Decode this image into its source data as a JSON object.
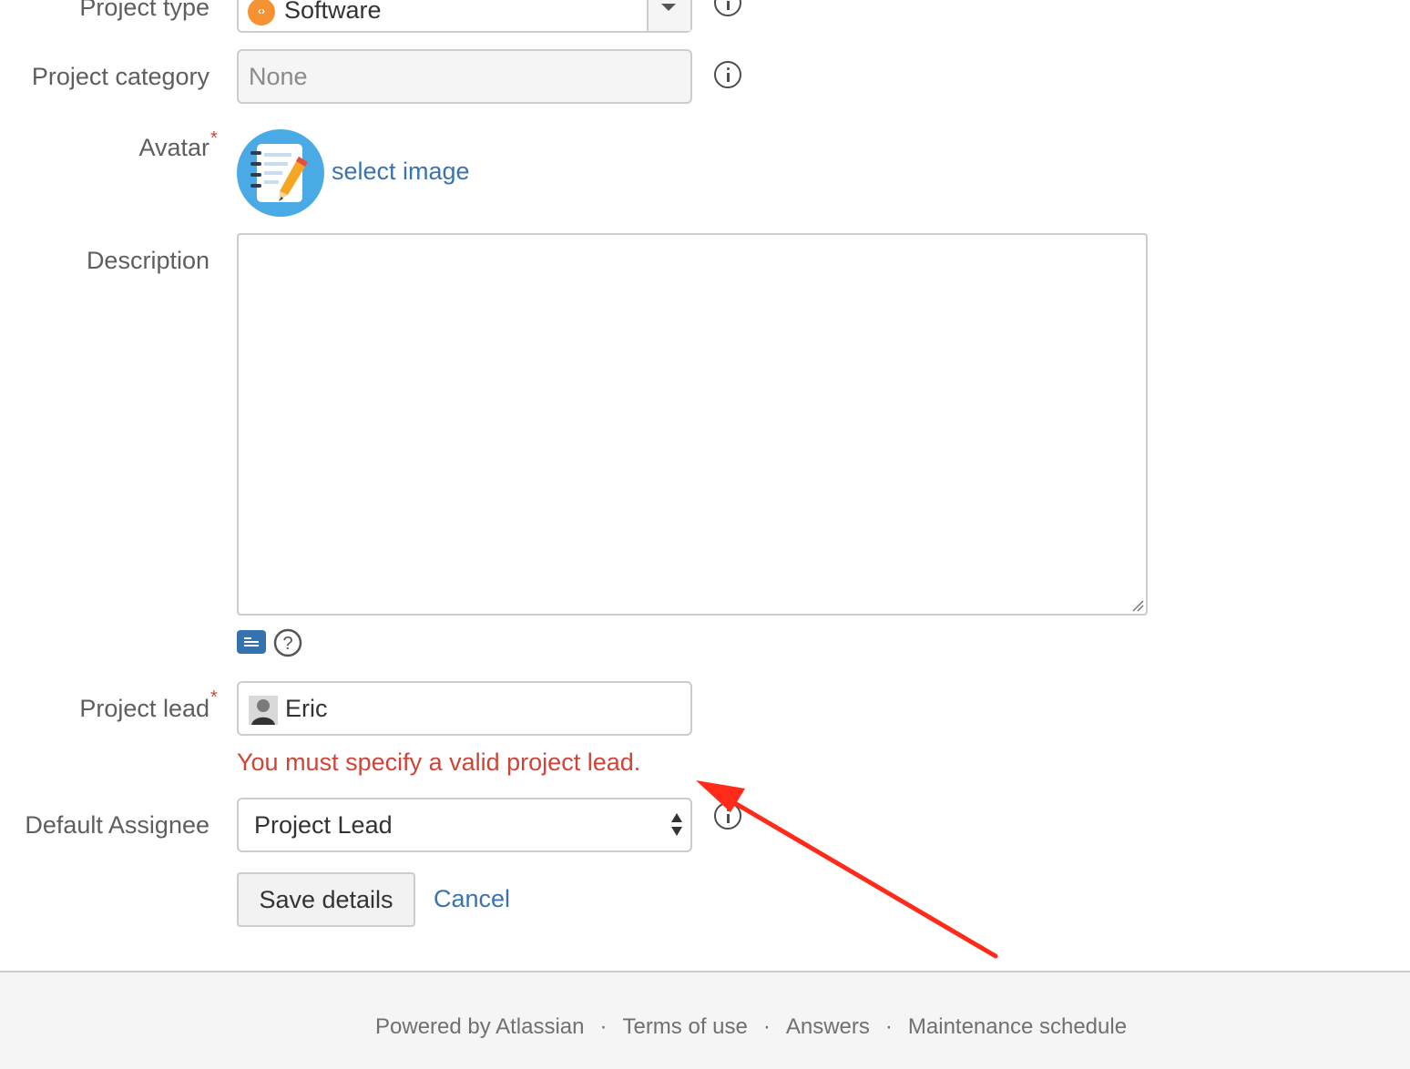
{
  "form": {
    "project_type": {
      "label": "Project type",
      "value": "Software"
    },
    "project_category": {
      "label": "Project category",
      "placeholder": "None"
    },
    "avatar": {
      "label": "Avatar",
      "required_mark": "*",
      "link": "select image"
    },
    "description": {
      "label": "Description",
      "value": ""
    },
    "project_lead": {
      "label": "Project lead",
      "required_mark": "*",
      "value": "Eric",
      "error": "You must specify a valid project lead."
    },
    "default_assignee": {
      "label": "Default Assignee",
      "value": "Project Lead"
    },
    "buttons": {
      "save": "Save details",
      "cancel": "Cancel"
    }
  },
  "footer": {
    "links": [
      "Powered by Atlassian",
      "Terms of use",
      "Answers",
      "Maintenance schedule"
    ],
    "separator": "·"
  },
  "colors": {
    "link": "#3b73af",
    "error": "#d04437",
    "annotation_arrow": "#ff2a1a",
    "software_badge": "#f79232"
  },
  "icons": {
    "project_type": "software-icon",
    "info": "info-icon",
    "avatar": "notebook-pencil-icon",
    "text_mode": "wiki-renderer-icon",
    "help": "question-circle-icon",
    "select_arrows": "up-down-arrows-icon",
    "lead_avatar": "user-avatar-icon"
  }
}
